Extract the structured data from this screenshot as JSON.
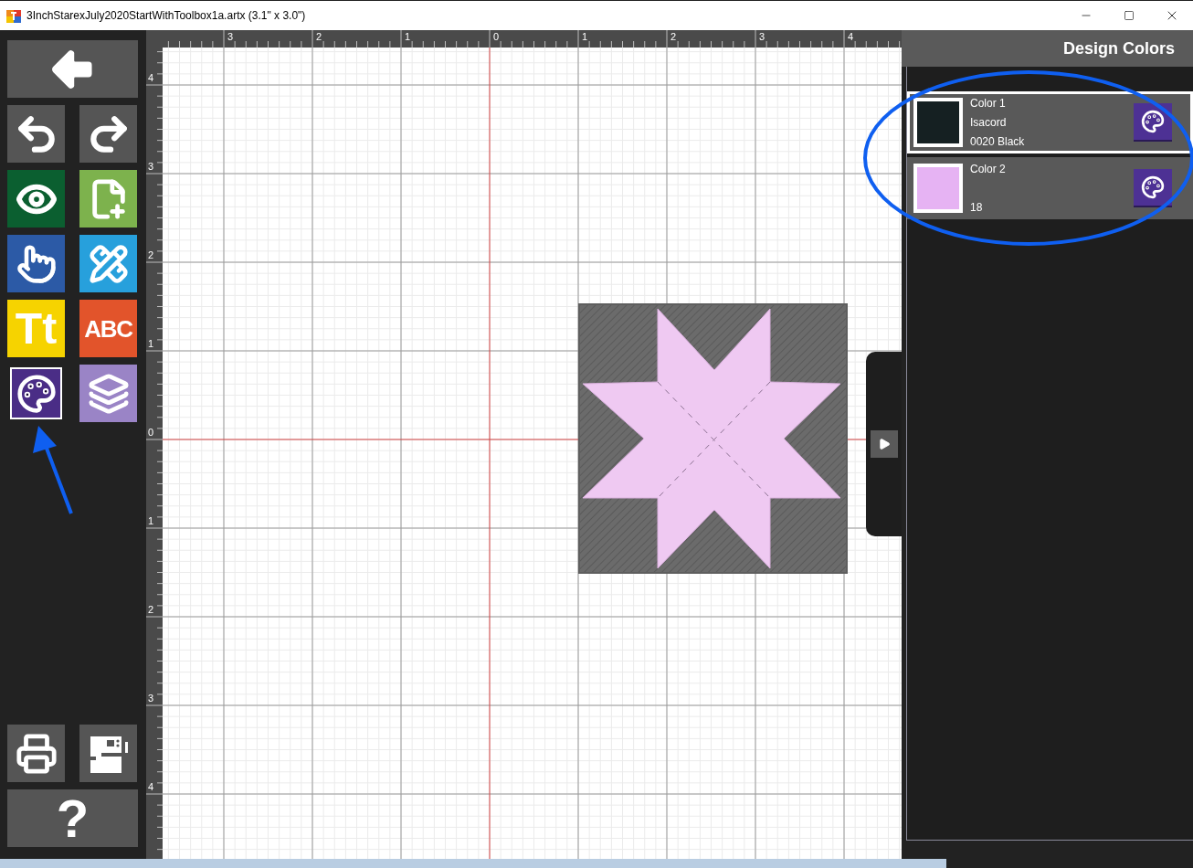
{
  "window": {
    "title": "3InchStarexJuly2020StartWithToolbox1a.artx (3.1\" x 3.0\")"
  },
  "toolbar": {
    "tools": [
      {
        "kind": "back",
        "selected": false
      },
      {
        "kind": "undo",
        "selected": false
      },
      {
        "kind": "redo",
        "selected": false
      },
      {
        "kind": "view",
        "selected": false
      },
      {
        "kind": "add-design",
        "selected": false
      },
      {
        "kind": "select",
        "selected": false
      },
      {
        "kind": "edit",
        "selected": false
      },
      {
        "kind": "text",
        "glyph": "Tt",
        "selected": false
      },
      {
        "kind": "monogram",
        "glyph": "ABC",
        "selected": false
      },
      {
        "kind": "colors",
        "selected": true
      },
      {
        "kind": "layers",
        "selected": false
      }
    ],
    "bottom_tools": [
      {
        "kind": "print"
      },
      {
        "kind": "sew"
      },
      {
        "kind": "help",
        "glyph": "?"
      }
    ]
  },
  "rulers": {
    "horizontal": [
      "3",
      "2",
      "1",
      "0",
      "1",
      "2",
      "3",
      "4"
    ],
    "vertical": [
      "4",
      "3",
      "2",
      "1",
      "0",
      "1",
      "2",
      "3",
      "4"
    ]
  },
  "panel": {
    "title": "Design Colors",
    "colors": [
      {
        "name": "Color 1",
        "brand": "Isacord",
        "thread": "0020 Black",
        "color": "#152022",
        "selected": true
      },
      {
        "name": "Color 2",
        "thread": "18",
        "color": "#e6b3f3",
        "selected": false
      }
    ]
  }
}
